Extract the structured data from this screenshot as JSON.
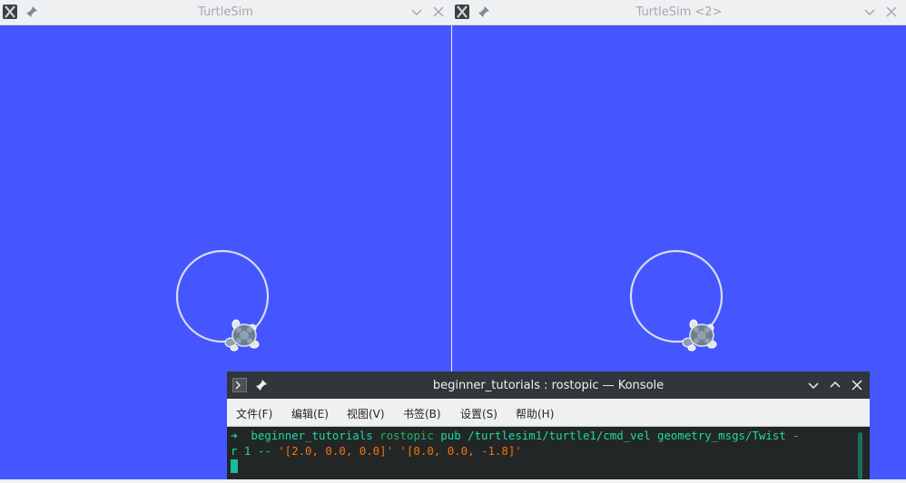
{
  "windows": [
    {
      "title": "TurtleSim"
    },
    {
      "title": "TurtleSim <2>"
    }
  ],
  "konsole": {
    "title": "beginner_tutorials : rostopic — Konsole",
    "menu": [
      "文件(F)",
      "编辑(E)",
      "视图(V)",
      "书签(B)",
      "设置(S)",
      "帮助(H)"
    ],
    "prompt_symbol": "➜",
    "cwd": "beginner_tutorials",
    "command": "rostopic",
    "args_line1": "pub /turtlesim1/turtle1/cmd_vel geometry_msgs/Twist -",
    "args_line2_a": "r 1 -- ",
    "args_line2_b": "'[2.0, 0.0, 0.0]' '[0.0, 0.0, -1.8]'"
  },
  "colors": {
    "canvas_bg": "#4556ff",
    "trail": "#d8dcf0",
    "terminal_bg": "#232627",
    "prompt_green": "#1cdc9a",
    "string_orange": "#f67400"
  },
  "icons": [
    "x-app-icon",
    "pin-icon",
    "chevron-down-icon",
    "close-icon",
    "terminal-icon",
    "chevron-up-icon",
    "turtle-icon"
  ]
}
